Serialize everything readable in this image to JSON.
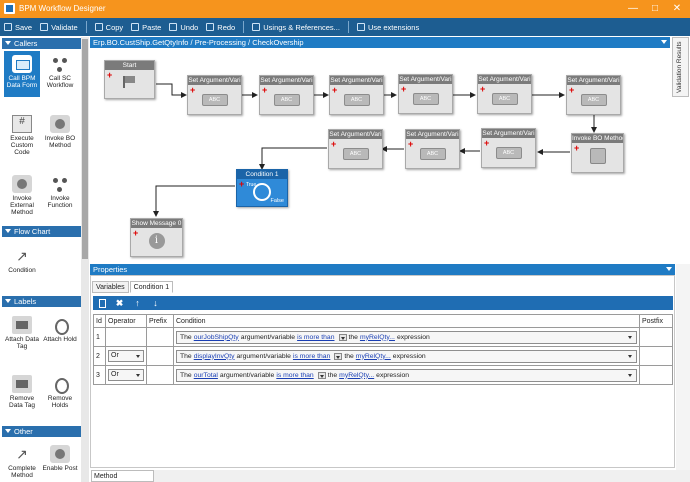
{
  "window": {
    "title": "BPM Workflow Designer",
    "min": "—",
    "max": "□",
    "close": "✕"
  },
  "toolbar": [
    {
      "label": "Save",
      "icon": "save-icon"
    },
    {
      "label": "Validate",
      "icon": "validate-icon"
    },
    {
      "label": "Copy",
      "icon": "copy-icon"
    },
    {
      "label": "Paste",
      "icon": "paste-icon"
    },
    {
      "label": "Undo",
      "icon": "undo-icon"
    },
    {
      "label": "Redo",
      "icon": "redo-icon"
    },
    {
      "label": "Usings & References...",
      "icon": "references-icon"
    },
    {
      "label": "Use extensions",
      "icon": "extensions-icon"
    }
  ],
  "toolbox": {
    "callers": "Callers",
    "call_bpm": "Call BPM Data Form",
    "call_sc": "Call SC Workflow",
    "execute_code": "Execute Custom Code",
    "invoke_bo": "Invoke BO Method",
    "invoke_external": "Invoke External Method",
    "invoke_function": "Invoke Function",
    "flow_chart": "Flow Chart",
    "condition": "Condition",
    "labels": "Labels",
    "attach_tag": "Attach Data Tag",
    "attach_hold": "Attach Hold",
    "remove_tag": "Remove Data Tag",
    "remove_holds": "Remove Holds",
    "other": "Other",
    "complete": "Complete Method",
    "enable": "Enable Post"
  },
  "designer": {
    "path": "Erp.BO.CustShip.GetQtyInfo / Pre-Processing / CheckOvership",
    "validation_tab": "Validation Results"
  },
  "nodes": {
    "start": "Start",
    "set_arg": "Set Argument/Vari",
    "abc": "ABC",
    "invoke_bo": "Invoke BO Method",
    "condition": "Condition 1",
    "cond_true": "True",
    "cond_false": "False",
    "show_message": "Show Message 0",
    "info_glyph": "i"
  },
  "properties": {
    "title": "Properties",
    "tabs": [
      "Variables",
      "Condition 1"
    ],
    "footer_tab": "Method parameters",
    "toolbar_icons": [
      "new-icon",
      "delete-icon",
      "move-up-icon",
      "move-down-icon"
    ],
    "columns": {
      "id": "Id",
      "operator": "Operator",
      "prefix": "Prefix",
      "condition": "Condition",
      "postfix": "Postfix"
    },
    "rows": [
      {
        "id": "1",
        "operator": "",
        "prefix": "",
        "the": "The",
        "var": "ourJobShipQty",
        "mid": "argument/variable",
        "op": "is more than",
        "the2": "the",
        "target": "myRelQty...",
        "end": "expression",
        "postfix": ""
      },
      {
        "id": "2",
        "operator": "Or",
        "prefix": "",
        "the": "The",
        "var": "displayInvQty",
        "mid": "argument/variable",
        "op": "is more than",
        "the2": "the",
        "target": "myRelQty...",
        "end": "expression",
        "postfix": ""
      },
      {
        "id": "3",
        "operator": "Or",
        "prefix": "",
        "the": "The",
        "var": "ourTotal",
        "mid": "argument/variable",
        "op": "is more than",
        "the2": "the",
        "target": "myRelQty...",
        "end": "expression",
        "postfix": ""
      }
    ]
  },
  "colors": {
    "titlebar": "#f6941d",
    "toolbar": "#1d5d91",
    "accent": "#1f7bc4",
    "condition_node": "#2f8ad8"
  }
}
